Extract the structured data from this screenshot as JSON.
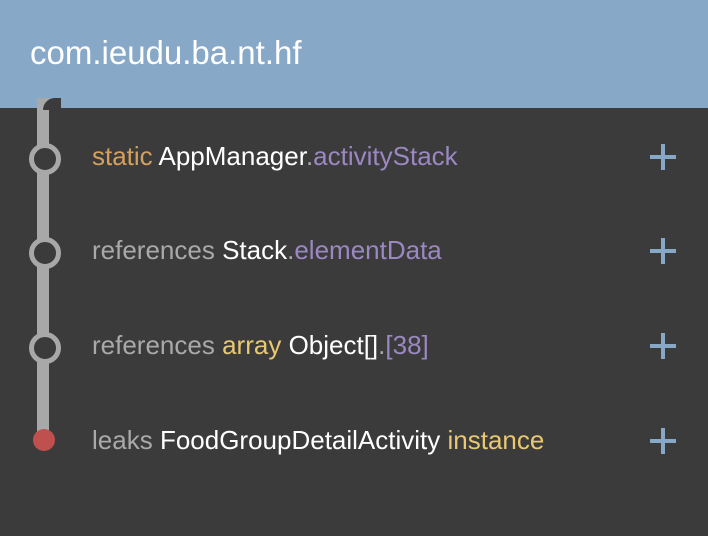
{
  "header": {
    "title": "com.ieudu.ba.nt.hf"
  },
  "trace": [
    {
      "keyword": "static",
      "class_name": "AppManager",
      "dot": ".",
      "field": "activityStack"
    },
    {
      "keyword": "references",
      "class_name": "Stack",
      "dot": ".",
      "field": "elementData"
    },
    {
      "keyword": "references",
      "kind": "array",
      "class_name": "Object[]",
      "dot": ".",
      "field": "[38]"
    },
    {
      "keyword": "leaks",
      "class_name": "FoodGroupDetailActivity",
      "kind": "instance"
    }
  ],
  "colors": {
    "header": "#88a8c8",
    "background": "#3b3b3b",
    "timeline": "#a8a8a8",
    "leak": "#c0504d",
    "static": "#d4a05e",
    "field": "#9b88c2",
    "type": "#e8c872"
  },
  "icons": {
    "expand": "plus-icon",
    "node": "ring-icon",
    "leak": "dot-icon"
  }
}
